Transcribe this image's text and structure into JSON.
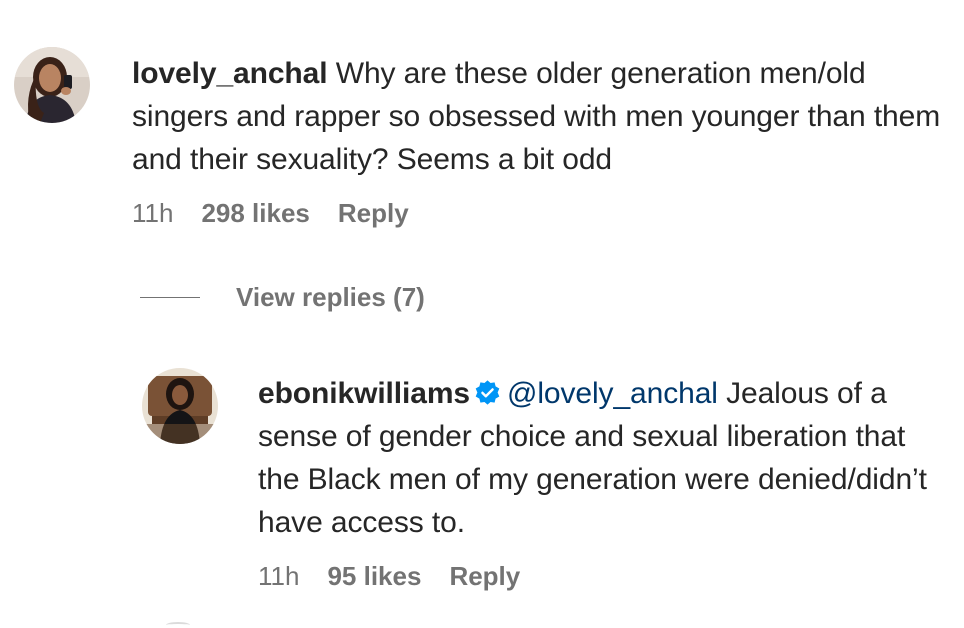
{
  "comments": [
    {
      "username": "lovely_anchal",
      "text": "Why are these older generation men/old singers and rapper so obsessed with men younger than them and their sexuality? Seems a bit odd",
      "time": "11h",
      "likes": "298 likes",
      "reply_label": "Reply",
      "avatar_icon": "user-avatar-photo"
    },
    {
      "username": "ebonikwilliams",
      "verified": true,
      "mention": "@lovely_anchal",
      "text": "Jealous of a sense of gender choice and sexual liberation that the Black men of my generation were denied/didn’t have access to.",
      "time": "11h",
      "likes": "95 likes",
      "reply_label": "Reply",
      "avatar_icon": "user-avatar-photo"
    }
  ],
  "view_replies": {
    "label": "View replies (7)"
  },
  "colors": {
    "text": "#262626",
    "secondary": "#737373",
    "mention": "#00376b",
    "verified": "#0095f6"
  }
}
